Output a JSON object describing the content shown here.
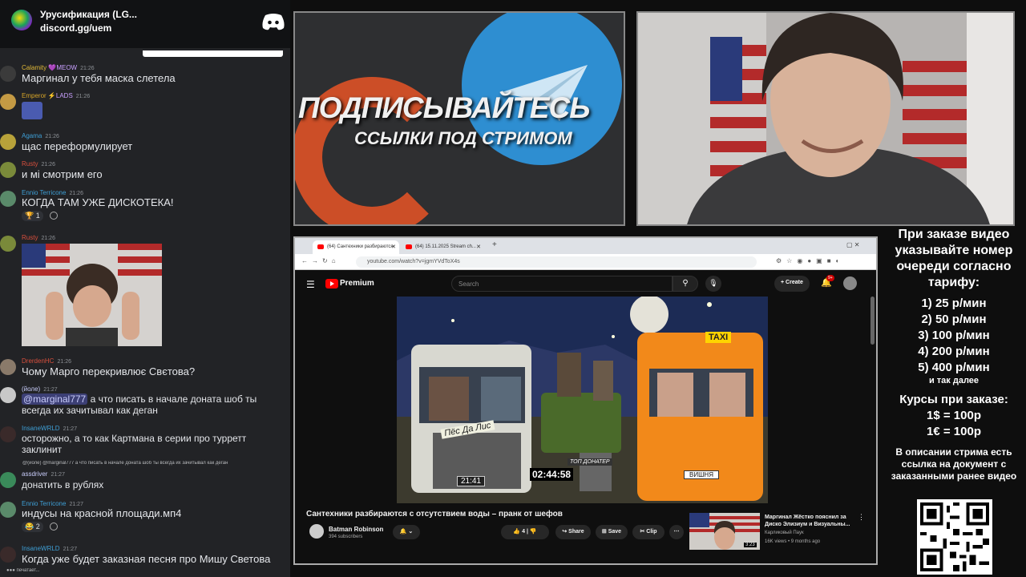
{
  "chat": {
    "server_title": "Урусификация (LG...",
    "server_invite": "discord.gg/uem",
    "messages": [
      {
        "name": "Calamity",
        "tag": "💜MEOW",
        "time": "21:26",
        "text": "Маргинал у тебя маска слетела",
        "color": "#e0b838"
      },
      {
        "name": "Emperor",
        "tag": "⚡LADS",
        "time": "21:26",
        "text": "",
        "color": "#d8a528"
      },
      {
        "name": "Agama",
        "tag": "",
        "time": "21:26",
        "text": "щас переформулирует",
        "color": "#3e9fd6"
      },
      {
        "name": "Rusty",
        "tag": "",
        "time": "21:26",
        "text": "и мі смотрим его",
        "color": "#d94f3d"
      },
      {
        "name": "Ennio Terricone",
        "tag": "",
        "time": "21:26",
        "text": "КОГДА ТАМ УЖЕ ДИСКОТЕКА!",
        "color": "#3e9fd6",
        "reaction_count": "1"
      },
      {
        "name": "Rusty",
        "tag": "",
        "time": "21:26",
        "text": "",
        "color": "#d94f3d"
      },
      {
        "name": "DrerdenHC",
        "tag": "",
        "time": "21:26",
        "text": "Чому Марго перекривлює Свєтова?",
        "color": "#d94f3d"
      },
      {
        "name": "(йоле)",
        "tag": "",
        "time": "21:27",
        "mention": "@marginal777",
        "text": "а что писать в начале доната шоб ты всегда их зачитывал как деган",
        "color": "#c9cdfb"
      },
      {
        "name": "InsaneWRLD",
        "tag": "",
        "time": "21:27",
        "text": "осторожно, а то как Картмана в серии про турретт заклинит",
        "color": "#3e9fd6"
      },
      {
        "name": "assdriver",
        "tag": "",
        "time": "21:27",
        "reply": "@(йоле) @marginal777 а что писать в начале доната шоб ты всегда их зачитывал как деган",
        "text": "донатить в рублях",
        "color": "#c9cdfb"
      },
      {
        "name": "Ennio Terricone",
        "tag": "",
        "time": "21:27",
        "text": "индусы на красной площади.мп4",
        "color": "#3e9fd6",
        "reaction_count": "2"
      },
      {
        "name": "InsaneWRLD",
        "tag": "",
        "time": "21:27",
        "text": "Когда уже будет заказная песня про Мишу Светова",
        "color": "#3e9fd6"
      }
    ],
    "typing": "печатает..."
  },
  "promo": {
    "headline": "ПОДПИСЫВАЙТЕСЬ",
    "sub": "ССЫЛКИ ПОД СТРИМОМ"
  },
  "browser": {
    "tabs": [
      "(64) Сантехники разбираются",
      "(64) 15.11.2025 Stream ch..."
    ],
    "url": "youtube.com/watch?v=jgmYVdToX4s",
    "brand": "Premium",
    "search_placeholder": "Search",
    "create_label": "Create",
    "notif_badge": "9+"
  },
  "video": {
    "title": "Сантехники разбираются с отсутствием воды – пранк от шефов",
    "channel": "Batman Robinson",
    "subscribers": "394 subscribers",
    "likes": "4",
    "share": "Share",
    "save": "Save",
    "clip": "Clip",
    "timer": "02:44:58",
    "top_donater": "ТОП ДОНАТЕР",
    "plate1": "21:41",
    "sign_text": "Пёс Да Лис",
    "taxi_text": "TAXI",
    "plate2": "ВИШНЯ"
  },
  "recommended": {
    "title": "Маргинал Жёстко пояснил за Диско Элизиум и Визуальны...",
    "channel": "Карликовый Паук",
    "meta": "16K views • 9 months ago",
    "duration": "3:23"
  },
  "info": {
    "order_note": "При заказе видео указывайте номер очереди согласно тарифу:",
    "tariffs": [
      "1) 25 р/мин",
      "2) 50 р/мин",
      "3) 100 р/мин",
      "4) 200 р/мин",
      "5) 400 р/мин"
    ],
    "etc": "и так далее",
    "rates_title": "Курсы при заказе:",
    "rate1": "1$ = 100р",
    "rate2": "1€ = 100р",
    "description": "В описании стрима есть ссылка на документ с заказанными ранее видео"
  }
}
